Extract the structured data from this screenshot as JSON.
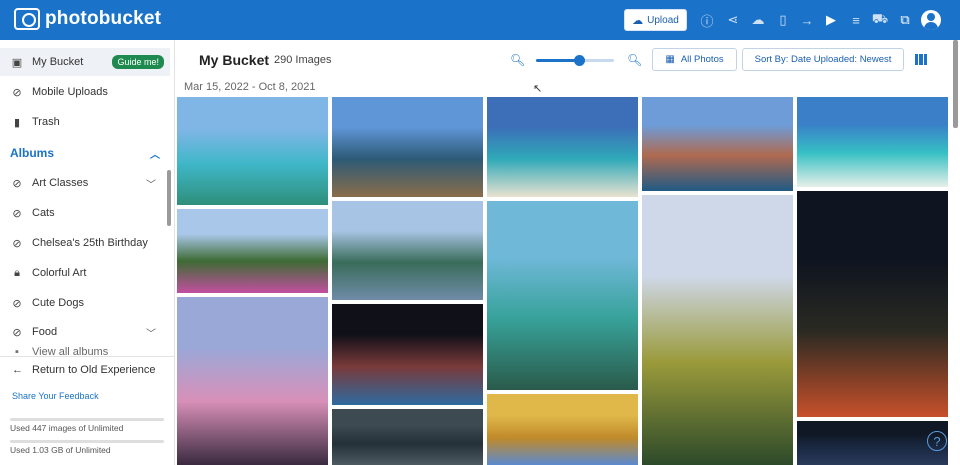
{
  "app": {
    "name": "photobucket"
  },
  "topbar": {
    "upload_label": "Upload",
    "icons": [
      "info-icon",
      "share-icon",
      "cloud-download-icon",
      "trash-icon",
      "move-icon",
      "slideshow-icon",
      "adjust-icon",
      "cart-icon",
      "link-icon",
      "account-icon"
    ]
  },
  "sidebar": {
    "items": [
      {
        "label": "My Bucket",
        "icon": "photo-frame-icon"
      },
      {
        "label": "Mobile Uploads",
        "icon": "hidden-eye-icon"
      },
      {
        "label": "Trash",
        "icon": "trash-icon"
      }
    ],
    "guide_label": "Guide me!",
    "albums_heading": "Albums",
    "albums": [
      {
        "label": "Art Classes",
        "icon": "hidden-eye-icon",
        "expandable": true
      },
      {
        "label": "Cats",
        "icon": "hidden-eye-icon",
        "expandable": false
      },
      {
        "label": "Chelsea's 25th Birthday",
        "icon": "hidden-eye-icon",
        "expandable": false
      },
      {
        "label": "Colorful Art",
        "icon": "lock-icon",
        "expandable": false
      },
      {
        "label": "Cute Dogs",
        "icon": "hidden-eye-icon",
        "expandable": false
      },
      {
        "label": "Food",
        "icon": "hidden-eye-icon",
        "expandable": true
      }
    ],
    "view_all_label": "View all albums",
    "return_label": "Return to Old Experience",
    "feedback_label": "Share Your Feedback",
    "usage_images": "Used 447 images of Unlimited",
    "usage_storage": "Used 1.03 GB of Unlimited"
  },
  "main": {
    "title": "My Bucket",
    "image_count": "290 Images",
    "date_range": "Mar 15, 2022 - Oct 8, 2021",
    "all_photos_label": "All Photos",
    "sort_label": "Sort By: Date Uploaded: Newest",
    "zoom_level": 0.55
  },
  "photos": [
    {
      "subject": "castle-on-alpine-lake",
      "colors": [
        "#7fb6e6",
        "#3fb7c8",
        "#2e8f7a"
      ]
    },
    {
      "subject": "tulip-field",
      "colors": [
        "#a9c7e8",
        "#3e6b34",
        "#c24fa0"
      ]
    },
    {
      "subject": "pink-sky-tractor",
      "colors": [
        "#9aa8d8",
        "#d890b8",
        "#3a2a40"
      ]
    },
    {
      "subject": "lake-house-mountains",
      "colors": [
        "#5f96d8",
        "#2d5a76",
        "#8a6d4a"
      ]
    },
    {
      "subject": "river-bend-valley",
      "colors": [
        "#a8c4e4",
        "#3a6c5a",
        "#6f8ba8"
      ]
    },
    {
      "subject": "stained-glass-window",
      "colors": [
        "#101018",
        "#7a3a3a",
        "#2e6aa0"
      ]
    },
    {
      "subject": "dark-sky",
      "colors": [
        "#3d4a52",
        "#253038",
        "#4d5a60"
      ]
    },
    {
      "subject": "overwater-bungalows",
      "colors": [
        "#3c6fb8",
        "#2fa9b8",
        "#e9e2d0"
      ]
    },
    {
      "subject": "turquoise-lagoon",
      "colors": [
        "#6fb8d8",
        "#37a29a",
        "#2a5b4a"
      ]
    },
    {
      "subject": "autumn-tree",
      "colors": [
        "#e0b84a",
        "#c08a2a",
        "#5a8ad0"
      ]
    },
    {
      "subject": "cinque-terre-village",
      "colors": [
        "#6d9cd8",
        "#b06a50",
        "#1f5a84"
      ]
    },
    {
      "subject": "meandering-river-plains",
      "colors": [
        "#cfd8e8",
        "#9a9a3a",
        "#2d4a2a"
      ]
    },
    {
      "subject": "tropical-island-aerial",
      "colors": [
        "#3a7fc8",
        "#36c0c4",
        "#e6efe8"
      ]
    },
    {
      "subject": "bokeh-christmas-lights",
      "colors": [
        "#0e1420",
        "#2a2a22",
        "#c8502a"
      ]
    },
    {
      "subject": "night-water",
      "colors": [
        "#101826",
        "#1a2a44",
        "#2a3a5a"
      ]
    }
  ]
}
